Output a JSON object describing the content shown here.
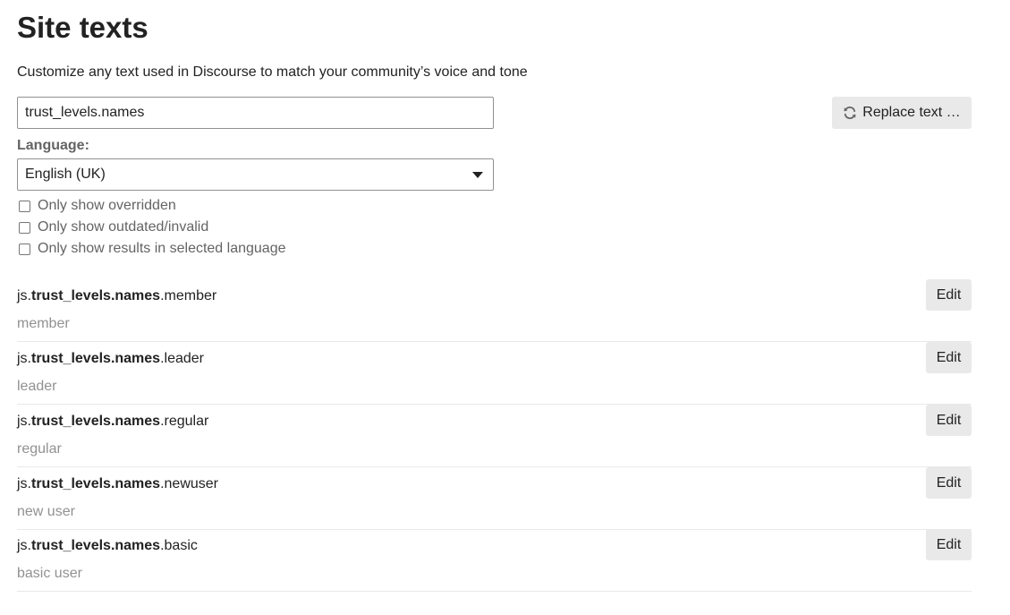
{
  "header": {
    "title": "Site texts",
    "subtitle": "Customize any text used in Discourse to match your community’s voice and tone"
  },
  "search": {
    "value": "trust_levels.names",
    "placeholder": ""
  },
  "replace_button": {
    "label": "Replace text …",
    "icon": "sync-icon"
  },
  "language": {
    "label": "Language:",
    "selected": "English (UK)"
  },
  "filters": [
    {
      "label": "Only show overridden",
      "checked": false
    },
    {
      "label": "Only show outdated/invalid",
      "checked": false
    },
    {
      "label": "Only show results in selected language",
      "checked": false
    }
  ],
  "results": [
    {
      "prefix": "js.",
      "match": "trust_levels.names",
      "suffix": ".member",
      "value": "member",
      "edit_label": "Edit"
    },
    {
      "prefix": "js.",
      "match": "trust_levels.names",
      "suffix": ".leader",
      "value": "leader",
      "edit_label": "Edit"
    },
    {
      "prefix": "js.",
      "match": "trust_levels.names",
      "suffix": ".regular",
      "value": "regular",
      "edit_label": "Edit"
    },
    {
      "prefix": "js.",
      "match": "trust_levels.names",
      "suffix": ".newuser",
      "value": "new user",
      "edit_label": "Edit"
    },
    {
      "prefix": "js.",
      "match": "trust_levels.names",
      "suffix": ".basic",
      "value": "basic user",
      "edit_label": "Edit"
    }
  ],
  "colors": {
    "primary_text": "#222222",
    "muted_text": "#919191",
    "button_bg": "#e9e9e9",
    "border": "#919191"
  }
}
